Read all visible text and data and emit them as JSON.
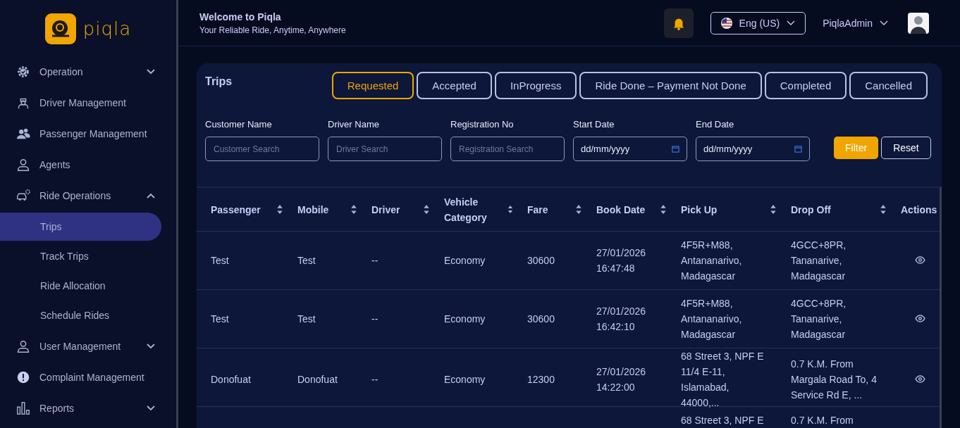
{
  "brand": {
    "name": "piqla"
  },
  "sidebar": {
    "items": [
      {
        "label": "Operation",
        "expanded": false
      },
      {
        "label": "Driver Management"
      },
      {
        "label": "Passenger Management"
      },
      {
        "label": "Agents"
      },
      {
        "label": "Ride Operations",
        "expanded": true,
        "children": [
          {
            "label": "Trips",
            "selected": true
          },
          {
            "label": "Track Trips",
            "selected": false
          },
          {
            "label": "Ride Allocation",
            "selected": false
          },
          {
            "label": "Schedule Rides",
            "selected": false
          }
        ]
      },
      {
        "label": "User Management",
        "expanded": false
      },
      {
        "label": "Complaint Management"
      },
      {
        "label": "Reports",
        "expanded": false
      }
    ]
  },
  "header": {
    "title": "Welcome to Piqla",
    "subtitle": "Your Reliable Ride, Anytime, Anywhere",
    "language": "Eng (US)",
    "user": "PiqlaAdmin"
  },
  "trips": {
    "title": "Trips",
    "tabs": [
      {
        "label": "Requested",
        "selected": true
      },
      {
        "label": "Accepted",
        "selected": false
      },
      {
        "label": "InProgress",
        "selected": false
      },
      {
        "label": "Ride Done – Payment Not Done",
        "selected": false
      },
      {
        "label": "Completed",
        "selected": false
      },
      {
        "label": "Cancelled",
        "selected": false
      }
    ],
    "filters": [
      {
        "kind": "text",
        "label": "Customer Name",
        "placeholder": "Customer Search"
      },
      {
        "kind": "text",
        "label": "Driver Name",
        "placeholder": "Driver Search"
      },
      {
        "kind": "text",
        "label": "Registration No",
        "placeholder": "Registration Search"
      },
      {
        "kind": "date",
        "label": "Start Date",
        "value": "dd/mm/yyyy"
      },
      {
        "kind": "date",
        "label": "End Date",
        "value": "dd/mm/yyyy"
      }
    ],
    "buttons": [
      {
        "kind": "primary",
        "label": "Filter"
      },
      {
        "kind": "secondary",
        "label": "Reset"
      }
    ],
    "table": {
      "columns": [
        {
          "label": "Passenger",
          "sortable": true
        },
        {
          "label": "Mobile",
          "sortable": true
        },
        {
          "label": "Driver",
          "sortable": true
        },
        {
          "label": "Vehicle Category",
          "sortable": true
        },
        {
          "label": "Fare",
          "sortable": true
        },
        {
          "label": "Book Date",
          "sortable": true
        },
        {
          "label": "Pick Up",
          "sortable": true
        },
        {
          "label": "Drop Off",
          "sortable": true
        },
        {
          "label": "Actions",
          "sortable": false
        }
      ],
      "rows": [
        {
          "cells": [
            "Test",
            "Test",
            "--",
            "Economy",
            "30600",
            "27/01/2026 16:47:48",
            "4F5R+M88, Antananarivo, Madagascar",
            "4GCC+8PR, Tananarive, Madagascar"
          ],
          "view": true
        },
        {
          "cells": [
            "Test",
            "Test",
            "--",
            "Economy",
            "30600",
            "27/01/2026 16:42:10",
            "4F5R+M88, Antananarivo, Madagascar",
            "4GCC+8PR, Tananarive, Madagascar"
          ],
          "view": true
        },
        {
          "cells": [
            "Donofuat",
            "Donofuat",
            "--",
            "Economy",
            "12300",
            "27/01/2026 14:22:00",
            "68 Street 3, NPF E 11/4 E-11, Islamabad, 44000,...",
            "0.7 K.M. From Margala Road To, 4 Service Rd E, ..."
          ],
          "view": true
        },
        {
          "cells": [
            "",
            "",
            "",
            "",
            "",
            "",
            "68 Street 3, NPF E",
            "0.7 K.M. From"
          ],
          "view": false
        }
      ]
    }
  }
}
